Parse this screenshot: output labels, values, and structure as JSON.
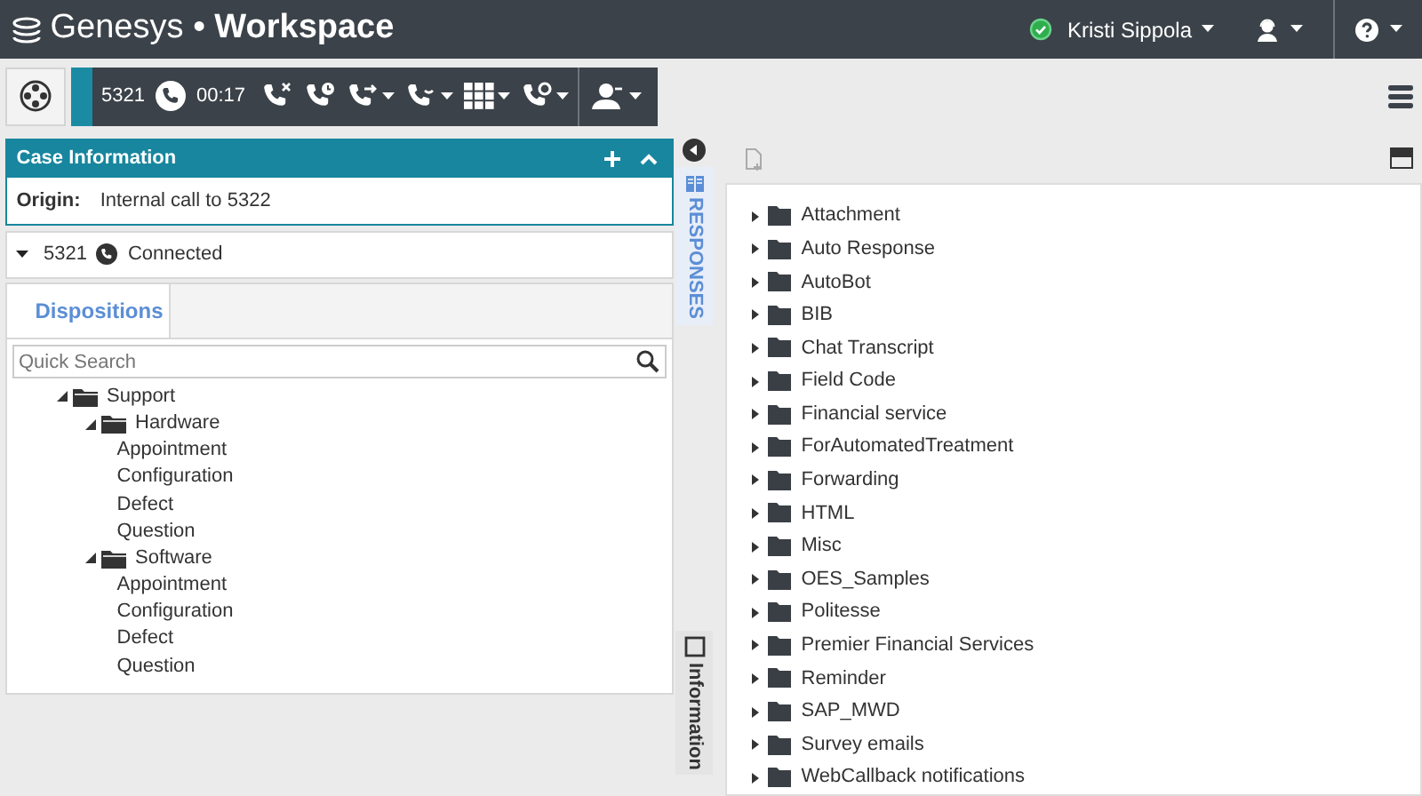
{
  "header": {
    "brand": "Genesys",
    "product": "• Workspace",
    "user_name": "Kristi Sippola"
  },
  "interaction_bar": {
    "number": "5321",
    "timer": "00:17"
  },
  "case_information": {
    "title": "Case Information",
    "origin_label": "Origin:",
    "origin_value": "Internal call to 5322"
  },
  "party": {
    "number": "5321",
    "status": "Connected"
  },
  "disposition_tabs": [
    {
      "label": "Dispositions",
      "selected": true
    }
  ],
  "search": {
    "placeholder": "Quick Search"
  },
  "dispositions": [
    {
      "label": "Support",
      "expanded": true,
      "children": [
        {
          "label": "Hardware",
          "expanded": true,
          "children": [
            {
              "label": "Appointment"
            },
            {
              "label": "Configuration"
            },
            {
              "label": "Defect"
            },
            {
              "label": "Question"
            }
          ]
        },
        {
          "label": "Software",
          "expanded": true,
          "children": [
            {
              "label": "Appointment"
            },
            {
              "label": "Configuration"
            },
            {
              "label": "Defect"
            },
            {
              "label": "Question"
            }
          ]
        }
      ]
    }
  ],
  "side_tabs": [
    {
      "label": "RESPONSES",
      "kind": "responses",
      "selected": true
    },
    {
      "label": "Information",
      "kind": "information",
      "selected": false
    }
  ],
  "responses": [
    {
      "label": "Attachment",
      "expanded": false
    },
    {
      "label": "Auto Response",
      "expanded": false
    },
    {
      "label": "AutoBot",
      "expanded": false
    },
    {
      "label": "BIB",
      "expanded": false
    },
    {
      "label": "Chat Transcript",
      "expanded": false
    },
    {
      "label": "Field Code",
      "expanded": false
    },
    {
      "label": "Financial service",
      "expanded": false
    },
    {
      "label": "ForAutomatedTreatment",
      "expanded": false
    },
    {
      "label": "Forwarding",
      "expanded": false
    },
    {
      "label": "HTML",
      "expanded": false
    },
    {
      "label": "Misc",
      "expanded": false
    },
    {
      "label": "OES_Samples",
      "expanded": false
    },
    {
      "label": "Politesse",
      "expanded": false
    },
    {
      "label": "Premier Financial Services",
      "expanded": false
    },
    {
      "label": "Reminder",
      "expanded": false
    },
    {
      "label": "SAP_MWD",
      "expanded": false
    },
    {
      "label": "Survey emails",
      "expanded": false
    },
    {
      "label": "WebCallback notifications",
      "expanded": false
    }
  ]
}
